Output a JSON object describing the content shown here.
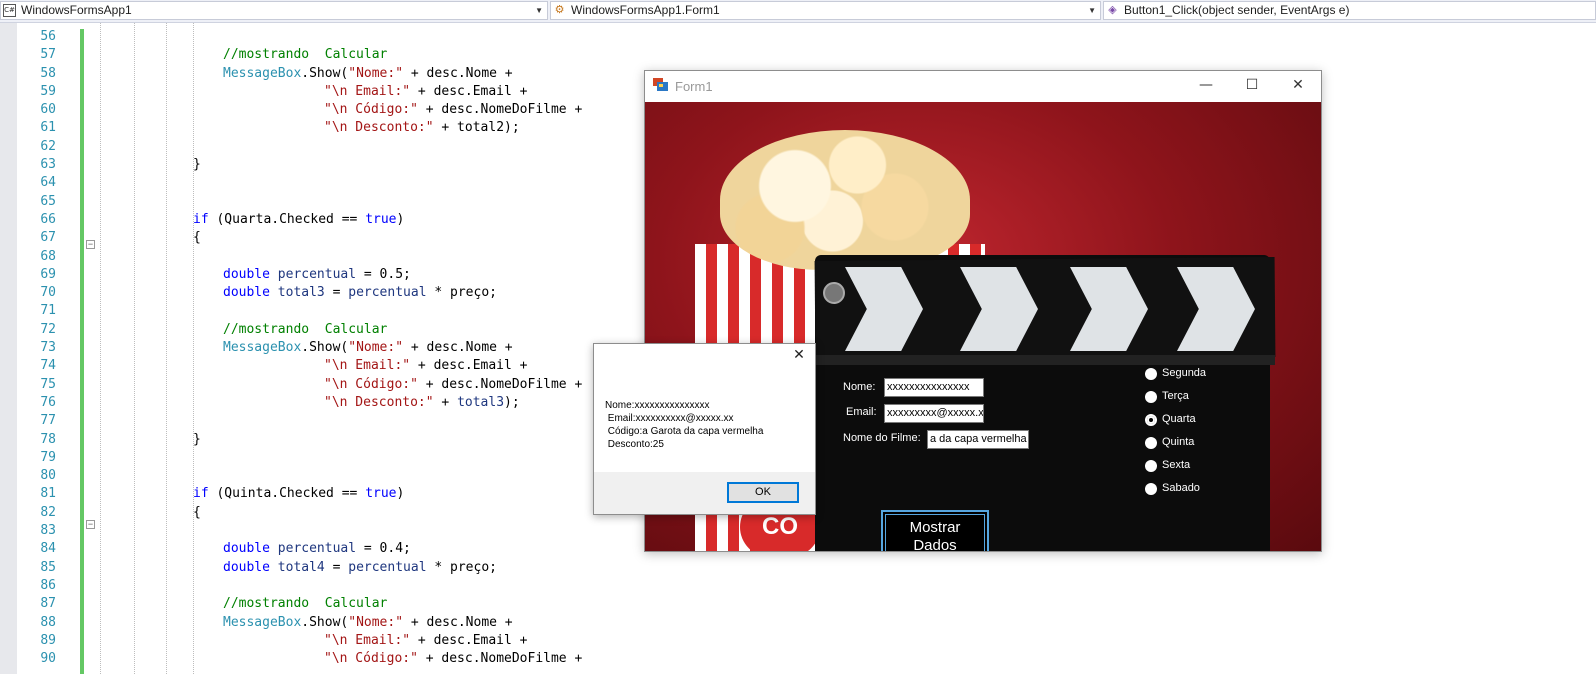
{
  "navbar": {
    "project": "WindowsFormsApp1",
    "class": "WindowsFormsApp1.Form1",
    "member": "Button1_Click(object sender, EventArgs e)",
    "project_icon": "csharp-project-icon",
    "class_icon": "class-icon",
    "member_icon": "method-icon"
  },
  "code": {
    "line_numbers": [
      "56",
      "57",
      "58",
      "59",
      "60",
      "61",
      "62",
      "63",
      "64",
      "65",
      "66",
      "67",
      "68",
      "69",
      "70",
      "71",
      "72",
      "73",
      "74",
      "75",
      "76",
      "77",
      "78",
      "79",
      "80",
      "81",
      "82",
      "83",
      "84",
      "85",
      "86",
      "87",
      "88",
      "89",
      "90"
    ],
    "l57": "//mostrando  Calcular",
    "l58a": "MessageBox",
    "l58b": ".Show(",
    "l58c": "\"Nome:\"",
    "l58d": " + desc.Nome +",
    "l59a": "\"\\n Email:\"",
    "l59b": " + desc.Email +",
    "l60a": "\"\\n Código:\"",
    "l60b": " + desc.NomeDoFilme +",
    "l61a": "\"\\n Desconto:\"",
    "l61b": " + total2);",
    "l63": "}",
    "l66a": "if",
    "l66b": " (Quarta.Checked == ",
    "l66c": "true",
    "l66d": ")",
    "l67": "{",
    "l69a": "double",
    "l69b": "percentual",
    "l69c": " = 0.5;",
    "l70a": "double",
    "l70b": "total3",
    "l70c": " = ",
    "l70d": "percentual",
    "l70e": " * preço;",
    "l72": "//mostrando  Calcular",
    "l73a": "MessageBox",
    "l73b": ".Show(",
    "l73c": "\"Nome:\"",
    "l73d": " + desc.Nome +",
    "l74a": "\"\\n Email:\"",
    "l74b": " + desc.Email +",
    "l75a": "\"\\n Código:\"",
    "l75b": " + desc.NomeDoFilme +",
    "l76a": "\"\\n Desconto:\"",
    "l76b": " + ",
    "l76c": "total3",
    "l76d": ");",
    "l78": "}",
    "l81a": "if",
    "l81b": " (Quinta.Checked == ",
    "l81c": "true",
    "l81d": ")",
    "l82": "{",
    "l84a": "double",
    "l84b": "percentual",
    "l84c": " = 0.4;",
    "l85a": "double",
    "l85b": "total4",
    "l85c": " = ",
    "l85d": "percentual",
    "l85e": " * preço;",
    "l87": "//mostrando  Calcular",
    "l88a": "MessageBox",
    "l88b": ".Show(",
    "l88c": "\"Nome:\"",
    "l88d": " + desc.Nome +",
    "l89a": "\"\\n Email:\"",
    "l89b": " + desc.Email +",
    "l90a": "\"\\n Código:\"",
    "l90b": " + desc.NomeDoFilme +"
  },
  "form1": {
    "title": "Form1",
    "min_glyph": "—",
    "max_glyph": "☐",
    "close_glyph": "✕",
    "nome_label": "Nome:",
    "nome_value": "xxxxxxxxxxxxxxx",
    "email_label": "Email:",
    "email_value": "xxxxxxxxx@xxxxx.xx",
    "filme_label": "Nome do Filme:",
    "filme_value": "a da capa vermelha",
    "days": [
      "Segunda",
      "Terça",
      "Quarta",
      "Quinta",
      "Sexta",
      "Sabado"
    ],
    "selected_day": "Quarta",
    "button_label_1": "Mostrar",
    "button_label_2": "Dados",
    "popcorn_logo": "CO"
  },
  "messagebox": {
    "close_glyph": "✕",
    "text": "Nome:xxxxxxxxxxxxxxx\n Email:xxxxxxxxxx@xxxxx.xx\n Código:a Garota da capa vermelha\n Desconto:25",
    "ok_label": "OK"
  },
  "colors": {
    "keyword": "#0000ff",
    "type": "#2b91af",
    "string": "#a31515",
    "comment": "#008000",
    "change_bar": "#64c864",
    "form_background": "#a01a22"
  }
}
